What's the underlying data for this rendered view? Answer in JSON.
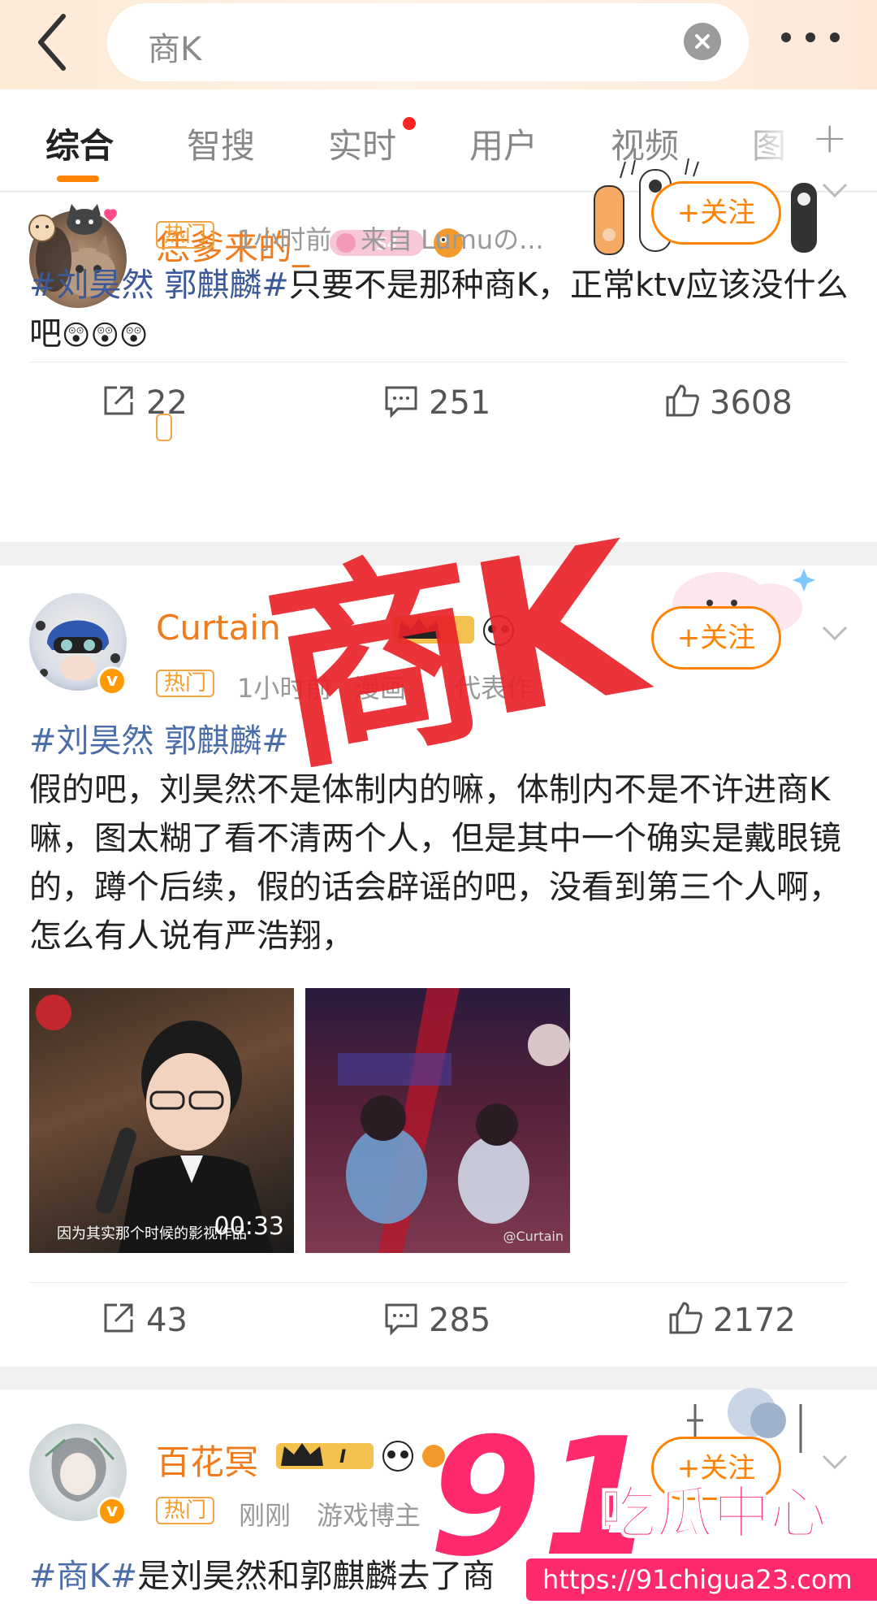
{
  "header": {
    "search_query": "商K"
  },
  "tabs": [
    {
      "label": "综合"
    },
    {
      "label": "智搜"
    },
    {
      "label": "实时"
    },
    {
      "label": "用户"
    },
    {
      "label": "视频"
    },
    {
      "label": "图"
    }
  ],
  "posts": [
    {
      "username": "恁爹来的_",
      "badge": "热门",
      "time": "1小时前",
      "source": "来自 Lumuの...",
      "follow_label": "关注",
      "hashtag": "#刘昊然 郭麒麟#",
      "text": "只要不是那种商K，正常ktv应该没什么吧",
      "emoji": "😲😲😲",
      "reposts": "22",
      "comments": "251",
      "likes": "3608"
    },
    {
      "username": "Curtain",
      "badge": "热门",
      "time": "1小时前",
      "source": "漫画",
      "source2": "代表作",
      "follow_label": "关注",
      "hashtag": "#刘昊然 郭麒麟#",
      "text": "假的吧，刘昊然不是体制内的嘛，体制内不是不许进商K嘛，图太糊了看不清两个人，但是其中一个确实是戴眼镜的，蹲个后续，假的话会辟谣的吧，没看到第三个人啊，怎么有人说有严浩翔，",
      "video_duration": "00:33",
      "video_caption": "因为其实那个时候的影视作品",
      "photo_watermark": "@Curtain",
      "reposts": "43",
      "comments": "285",
      "likes": "2172"
    },
    {
      "username": "百花冥",
      "badge": "热门",
      "time": "刚刚",
      "source": "游戏博主",
      "follow_label": "关注",
      "hashtag": "#商K#",
      "text": "是刘昊然和郭麒麟去了商"
    }
  ],
  "overlay": {
    "stamp_text": "商K",
    "logo_number": "91",
    "logo_cn": "吃瓜中心",
    "logo_url": "https://91chigua23.com"
  },
  "colors": {
    "accent": "#ff8200",
    "username": "#f07b1c",
    "hashtag": "#3b5998",
    "stamp": "#e9232a"
  }
}
